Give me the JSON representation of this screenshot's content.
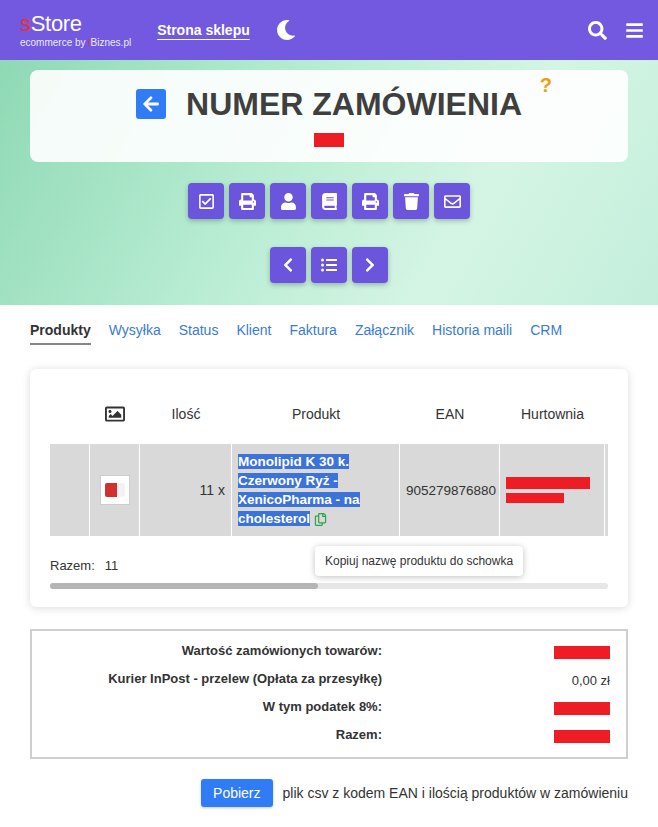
{
  "header": {
    "logo": {
      "accent": "s",
      "rest": "Store"
    },
    "subtitle": {
      "prefix": "ecommerce by ",
      "accent": "i",
      "rest": "Biznes.pl"
    },
    "link": "Strona sklepu"
  },
  "title": {
    "text": "NUMER ZAMÓWIENIA",
    "help": "?",
    "order_number_redacted": true
  },
  "tabs": [
    {
      "label": "Produkty",
      "selected": true
    },
    {
      "label": "Wysyłka",
      "selected": false
    },
    {
      "label": "Status",
      "selected": false
    },
    {
      "label": "Klient",
      "selected": false
    },
    {
      "label": "Faktura",
      "selected": false
    },
    {
      "label": "Załącznik",
      "selected": false
    },
    {
      "label": "Historia maili",
      "selected": false
    },
    {
      "label": "CRM",
      "selected": false
    }
  ],
  "table": {
    "columns": [
      "Ilość",
      "Produkt",
      "EAN",
      "Hurtownia"
    ],
    "rows": [
      {
        "qty": "11 x",
        "product": "Monolipid K 30 k. Czerwony Ryż - XenicoPharma - na cholesterol",
        "highlighted": true,
        "ean": "905279876880",
        "wholesaler_redacted": true
      }
    ],
    "total": {
      "label": "Razem:",
      "value": "11"
    },
    "scroll": {
      "level": 0.48
    }
  },
  "tooltip": "Kopiuj nazwę produktu do schowka",
  "summary": [
    {
      "label": "Wartość zamówionych towarów:",
      "redacted": true
    },
    {
      "label": "Kurier InPost - przelew (Opłata za przesyłkę)",
      "value": "0,00 zł",
      "redacted": false
    },
    {
      "label": "W tym podatek 8%:",
      "redacted": true
    },
    {
      "label": "Razem:",
      "redacted": true
    }
  ],
  "download": {
    "button": "Pobierz",
    "text": "plik csv z kodem EAN i ilością produktów w zamówieniu"
  }
}
